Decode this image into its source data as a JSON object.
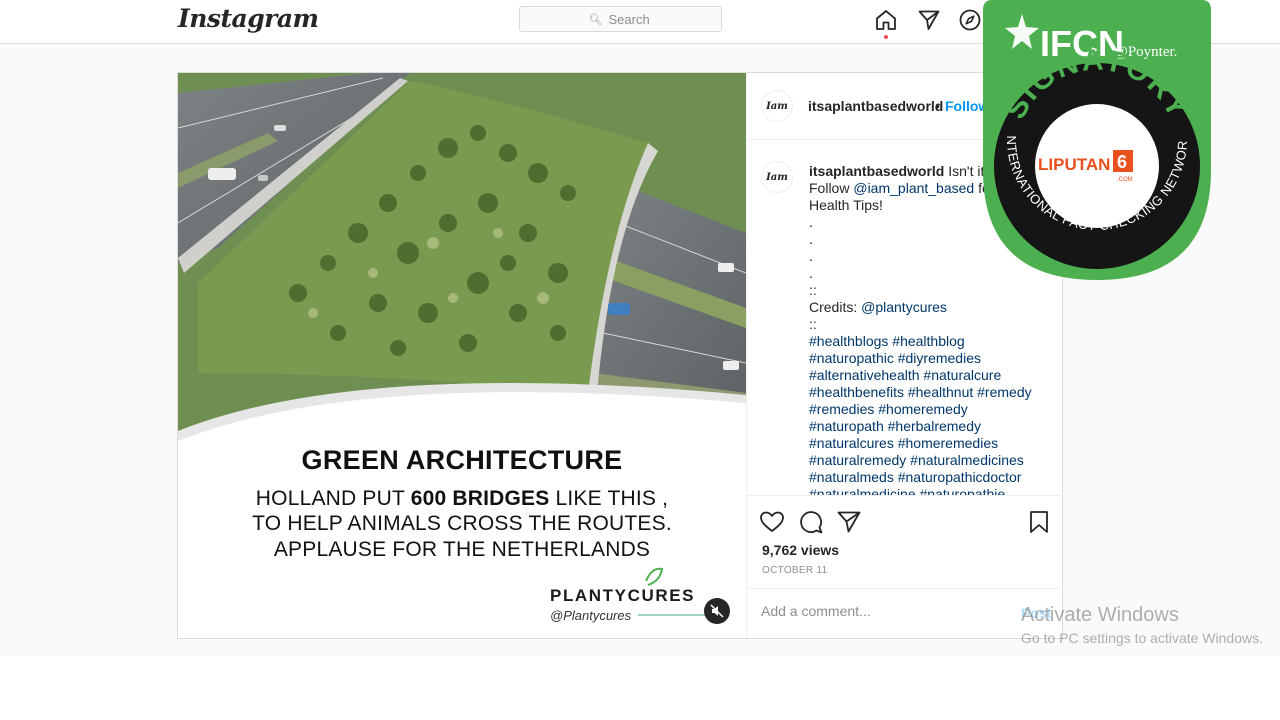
{
  "app": {
    "name": "Instagram"
  },
  "search": {
    "placeholder": "Search"
  },
  "nav": {
    "icons": [
      "home-icon",
      "direct-icon",
      "explore-icon"
    ]
  },
  "post": {
    "media": {
      "title": "GREEN ARCHITECTURE",
      "line1_pre": "HOLLAND PUT ",
      "line1_bold": "600 BRIDGES",
      "line1_post": " LIKE THIS ,",
      "line2": "TO HELP ANIMALS CROSS THE ROUTES.",
      "line3": "APPLAUSE FOR THE NETHERLANDS",
      "brand_name": "PLANTYCURES",
      "brand_handle": "@Plantycures"
    },
    "header": {
      "username": "itsaplantbasedworld",
      "dot": "•",
      "follow": "Follow",
      "avatar_text": "Iam"
    },
    "caption": {
      "username": "itsaplantbasedworld",
      "text_start": " Isn't it am",
      "follow_pre": "Follow ",
      "follow_mention": "@iam_plant_based",
      "follow_post": " for",
      "tips": "Health Tips!",
      "dots": [
        ".",
        ".",
        ".",
        "."
      ],
      "sep": "::",
      "credits_label": "Credits: ",
      "credits_mention": "@plantycures",
      "sep2": "::",
      "hashtag_lines": [
        "#healthblogs #healthblog",
        "#naturopathic #diyremedies",
        "#alternativehealth #naturalcure",
        "#healthbenefits #healthnut #remedy",
        "#remedies #homeremedy",
        "#naturopath #herbalremedy",
        "#naturalcures #homeremedies",
        "#naturalremedy #naturalmedicines",
        "#naturalmeds #naturopathicdoctor",
        "#naturalmedicine #naturopathie"
      ]
    },
    "views": "9,762 views",
    "date": "OCTOBER 11",
    "comment_placeholder": "Add a comment...",
    "post_button": "Post"
  },
  "badge": {
    "ifcn": "IFCN",
    "poynter": "@Poynter.",
    "signatory": "SIGNATORY",
    "network": "INTERNATIONAL FACT-CHECKING NETWORK",
    "member_name": "LIPUTAN",
    "member_digit": "6",
    "member_sub": ".COM",
    "colors": {
      "green": "#4caf50",
      "dark": "#151515",
      "orange": "#e8501d"
    }
  },
  "watermark": {
    "line1": "Activate Windows",
    "line2": "Go to PC settings to activate Windows."
  }
}
